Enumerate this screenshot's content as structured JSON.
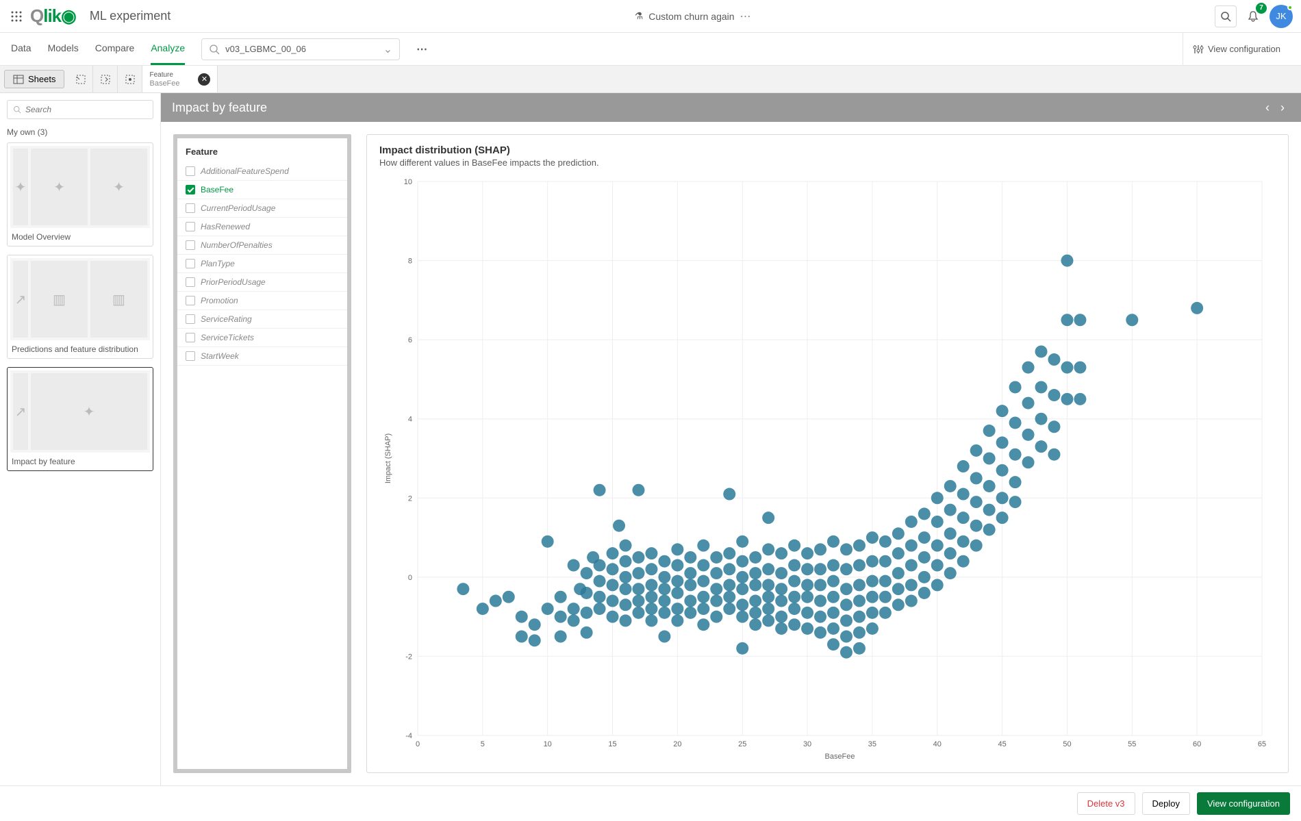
{
  "header": {
    "app_title": "ML experiment",
    "experiment_name": "Custom churn again",
    "notif_count": "7",
    "avatar": "JK"
  },
  "nav": {
    "tabs": [
      "Data",
      "Models",
      "Compare",
      "Analyze"
    ],
    "active": 3,
    "model_select": "v03_LGBMC_00_06",
    "view_config": "View configuration"
  },
  "toolbar": {
    "sheets_label": "Sheets",
    "chip": {
      "label": "Feature",
      "value": "BaseFee"
    }
  },
  "sidebar": {
    "search_placeholder": "Search",
    "myown_label": "My own (3)",
    "cards": [
      {
        "title": "Model Overview"
      },
      {
        "title": "Predictions and feature distribution"
      },
      {
        "title": "Impact by feature"
      }
    ],
    "active_card": 2
  },
  "content": {
    "header": "Impact by feature"
  },
  "feature_panel": {
    "title": "Feature",
    "items": [
      "AdditionalFeatureSpend",
      "BaseFee",
      "CurrentPeriodUsage",
      "HasRenewed",
      "NumberOfPenalties",
      "PlanType",
      "PriorPeriodUsage",
      "Promotion",
      "ServiceRating",
      "ServiceTickets",
      "StartWeek"
    ],
    "active": 1
  },
  "chart": {
    "title": "Impact distribution (SHAP)",
    "subtitle": "How different values in BaseFee impacts the prediction.",
    "ylabel": "Impact (SHAP)",
    "xlabel": "BaseFee"
  },
  "chart_data": {
    "type": "scatter",
    "xlabel": "BaseFee",
    "ylabel": "Impact (SHAP)",
    "x_ticks": [
      0,
      5,
      10,
      15,
      20,
      25,
      30,
      35,
      40,
      45,
      50,
      55,
      60,
      65
    ],
    "y_ticks": [
      -4,
      -2,
      0,
      2,
      4,
      6,
      8,
      10
    ],
    "xlim": [
      0,
      65
    ],
    "ylim": [
      -4,
      10
    ],
    "points": [
      [
        3.5,
        -0.3
      ],
      [
        5,
        -0.8
      ],
      [
        6,
        -0.6
      ],
      [
        7,
        -0.5
      ],
      [
        8,
        -1.0
      ],
      [
        8,
        -1.5
      ],
      [
        9,
        -1.6
      ],
      [
        9,
        -1.2
      ],
      [
        10,
        -0.8
      ],
      [
        10,
        0.9
      ],
      [
        11,
        -0.5
      ],
      [
        11,
        -1.0
      ],
      [
        11,
        -1.5
      ],
      [
        12,
        0.3
      ],
      [
        12,
        -0.8
      ],
      [
        12,
        -1.1
      ],
      [
        12.5,
        -0.3
      ],
      [
        13,
        0.1
      ],
      [
        13,
        -0.4
      ],
      [
        13,
        -0.9
      ],
      [
        13,
        -1.4
      ],
      [
        13.5,
        0.5
      ],
      [
        14,
        2.2
      ],
      [
        14,
        0.3
      ],
      [
        14,
        -0.1
      ],
      [
        14,
        -0.5
      ],
      [
        14,
        -0.8
      ],
      [
        15,
        0.6
      ],
      [
        15,
        0.2
      ],
      [
        15,
        -0.2
      ],
      [
        15,
        -0.6
      ],
      [
        15,
        -1.0
      ],
      [
        15.5,
        1.3
      ],
      [
        16,
        0.8
      ],
      [
        16,
        0.4
      ],
      [
        16,
        0.0
      ],
      [
        16,
        -0.3
      ],
      [
        16,
        -0.7
      ],
      [
        16,
        -1.1
      ],
      [
        17,
        2.2
      ],
      [
        17,
        0.5
      ],
      [
        17,
        0.1
      ],
      [
        17,
        -0.3
      ],
      [
        17,
        -0.6
      ],
      [
        17,
        -0.9
      ],
      [
        18,
        0.6
      ],
      [
        18,
        0.2
      ],
      [
        18,
        -0.2
      ],
      [
        18,
        -0.5
      ],
      [
        18,
        -0.8
      ],
      [
        18,
        -1.1
      ],
      [
        19,
        0.4
      ],
      [
        19,
        0.0
      ],
      [
        19,
        -0.3
      ],
      [
        19,
        -0.6
      ],
      [
        19,
        -0.9
      ],
      [
        19,
        -1.5
      ],
      [
        20,
        0.7
      ],
      [
        20,
        0.3
      ],
      [
        20,
        -0.1
      ],
      [
        20,
        -0.4
      ],
      [
        20,
        -0.8
      ],
      [
        20,
        -1.1
      ],
      [
        21,
        0.5
      ],
      [
        21,
        0.1
      ],
      [
        21,
        -0.2
      ],
      [
        21,
        -0.6
      ],
      [
        21,
        -0.9
      ],
      [
        22,
        0.8
      ],
      [
        22,
        0.3
      ],
      [
        22,
        -0.1
      ],
      [
        22,
        -0.5
      ],
      [
        22,
        -0.8
      ],
      [
        22,
        -1.2
      ],
      [
        23,
        0.5
      ],
      [
        23,
        0.1
      ],
      [
        23,
        -0.3
      ],
      [
        23,
        -0.6
      ],
      [
        23,
        -1.0
      ],
      [
        24,
        2.1
      ],
      [
        24,
        0.6
      ],
      [
        24,
        0.2
      ],
      [
        24,
        -0.2
      ],
      [
        24,
        -0.5
      ],
      [
        24,
        -0.8
      ],
      [
        25,
        0.9
      ],
      [
        25,
        0.4
      ],
      [
        25,
        0.0
      ],
      [
        25,
        -0.3
      ],
      [
        25,
        -0.7
      ],
      [
        25,
        -1.0
      ],
      [
        25,
        -1.8
      ],
      [
        26,
        0.5
      ],
      [
        26,
        0.1
      ],
      [
        26,
        -0.2
      ],
      [
        26,
        -0.6
      ],
      [
        26,
        -0.9
      ],
      [
        26,
        -1.2
      ],
      [
        27,
        1.5
      ],
      [
        27,
        0.7
      ],
      [
        27,
        0.2
      ],
      [
        27,
        -0.2
      ],
      [
        27,
        -0.5
      ],
      [
        27,
        -0.8
      ],
      [
        27,
        -1.1
      ],
      [
        28,
        0.6
      ],
      [
        28,
        0.1
      ],
      [
        28,
        -0.3
      ],
      [
        28,
        -0.6
      ],
      [
        28,
        -1.0
      ],
      [
        28,
        -1.3
      ],
      [
        29,
        0.8
      ],
      [
        29,
        0.3
      ],
      [
        29,
        -0.1
      ],
      [
        29,
        -0.5
      ],
      [
        29,
        -0.8
      ],
      [
        29,
        -1.2
      ],
      [
        30,
        0.6
      ],
      [
        30,
        0.2
      ],
      [
        30,
        -0.2
      ],
      [
        30,
        -0.5
      ],
      [
        30,
        -0.9
      ],
      [
        30,
        -1.3
      ],
      [
        31,
        0.7
      ],
      [
        31,
        0.2
      ],
      [
        31,
        -0.2
      ],
      [
        31,
        -0.6
      ],
      [
        31,
        -1.0
      ],
      [
        31,
        -1.4
      ],
      [
        32,
        0.9
      ],
      [
        32,
        0.3
      ],
      [
        32,
        -0.1
      ],
      [
        32,
        -0.5
      ],
      [
        32,
        -0.9
      ],
      [
        32,
        -1.3
      ],
      [
        32,
        -1.7
      ],
      [
        33,
        0.7
      ],
      [
        33,
        0.2
      ],
      [
        33,
        -0.3
      ],
      [
        33,
        -0.7
      ],
      [
        33,
        -1.1
      ],
      [
        33,
        -1.5
      ],
      [
        33,
        -1.9
      ],
      [
        34,
        0.8
      ],
      [
        34,
        0.3
      ],
      [
        34,
        -0.2
      ],
      [
        34,
        -0.6
      ],
      [
        34,
        -1.0
      ],
      [
        34,
        -1.4
      ],
      [
        34,
        -1.8
      ],
      [
        35,
        1.0
      ],
      [
        35,
        0.4
      ],
      [
        35,
        -0.1
      ],
      [
        35,
        -0.5
      ],
      [
        35,
        -0.9
      ],
      [
        35,
        -1.3
      ],
      [
        36,
        0.9
      ],
      [
        36,
        0.4
      ],
      [
        36,
        -0.1
      ],
      [
        36,
        -0.5
      ],
      [
        36,
        -0.9
      ],
      [
        37,
        1.1
      ],
      [
        37,
        0.6
      ],
      [
        37,
        0.1
      ],
      [
        37,
        -0.3
      ],
      [
        37,
        -0.7
      ],
      [
        38,
        1.4
      ],
      [
        38,
        0.8
      ],
      [
        38,
        0.3
      ],
      [
        38,
        -0.2
      ],
      [
        38,
        -0.6
      ],
      [
        39,
        1.6
      ],
      [
        39,
        1.0
      ],
      [
        39,
        0.5
      ],
      [
        39,
        0.0
      ],
      [
        39,
        -0.4
      ],
      [
        40,
        2.0
      ],
      [
        40,
        1.4
      ],
      [
        40,
        0.8
      ],
      [
        40,
        0.3
      ],
      [
        40,
        -0.2
      ],
      [
        41,
        2.3
      ],
      [
        41,
        1.7
      ],
      [
        41,
        1.1
      ],
      [
        41,
        0.6
      ],
      [
        41,
        0.1
      ],
      [
        42,
        2.8
      ],
      [
        42,
        2.1
      ],
      [
        42,
        1.5
      ],
      [
        42,
        0.9
      ],
      [
        42,
        0.4
      ],
      [
        43,
        3.2
      ],
      [
        43,
        2.5
      ],
      [
        43,
        1.9
      ],
      [
        43,
        1.3
      ],
      [
        43,
        0.8
      ],
      [
        44,
        3.7
      ],
      [
        44,
        3.0
      ],
      [
        44,
        2.3
      ],
      [
        44,
        1.7
      ],
      [
        44,
        1.2
      ],
      [
        45,
        4.2
      ],
      [
        45,
        3.4
      ],
      [
        45,
        2.7
      ],
      [
        45,
        2.0
      ],
      [
        45,
        1.5
      ],
      [
        46,
        4.8
      ],
      [
        46,
        3.9
      ],
      [
        46,
        3.1
      ],
      [
        46,
        2.4
      ],
      [
        46,
        1.9
      ],
      [
        47,
        5.3
      ],
      [
        47,
        4.4
      ],
      [
        47,
        3.6
      ],
      [
        47,
        2.9
      ],
      [
        48,
        5.7
      ],
      [
        48,
        4.8
      ],
      [
        48,
        4.0
      ],
      [
        48,
        3.3
      ],
      [
        49,
        5.5
      ],
      [
        49,
        4.6
      ],
      [
        49,
        3.8
      ],
      [
        49,
        3.1
      ],
      [
        50,
        8.0
      ],
      [
        50,
        6.5
      ],
      [
        50,
        5.3
      ],
      [
        50,
        4.5
      ],
      [
        51,
        6.5
      ],
      [
        51,
        5.3
      ],
      [
        51,
        4.5
      ],
      [
        55,
        6.5
      ],
      [
        60,
        6.8
      ]
    ]
  },
  "footer": {
    "delete": "Delete v3",
    "deploy": "Deploy",
    "view_config": "View configuration"
  }
}
